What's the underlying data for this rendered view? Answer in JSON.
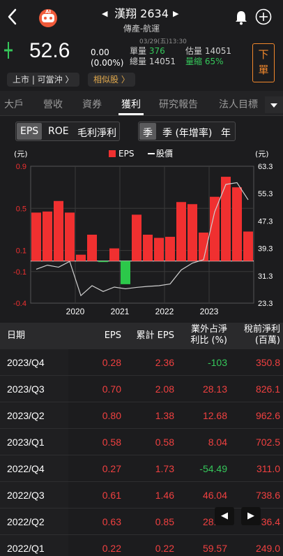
{
  "header": {
    "stock_name": "漢翔 2634",
    "stock_category": "傳產-航運",
    "ai_label": "AI",
    "prev_arrow": "◀",
    "next_arrow": "▶"
  },
  "quote": {
    "timestamp": "03/29(五)13:30",
    "price": "52.6",
    "change": "0.00",
    "change_pct": "(0.00%)",
    "vol_label": "單量",
    "vol_value": "376",
    "total_label": "總量",
    "total_value": "14051",
    "est_label": "估量",
    "est_value": "14051",
    "shrink_label": "量縮",
    "shrink_value": "65%",
    "order_button": "下單",
    "listing_pill": "上市 | 可當沖 〉",
    "similar_pill": "相似股 〉"
  },
  "tabs": [
    "大戶",
    "營收",
    "資券",
    "獲利",
    "研究報告",
    "法人目標"
  ],
  "active_tab": "獲利",
  "filters": {
    "metric": [
      "EPS",
      "ROE",
      "毛利淨利"
    ],
    "metric_selected": "EPS",
    "period": [
      "季",
      "季 (年增率)",
      "年"
    ],
    "period_selected": "季"
  },
  "chart_data": {
    "type": "bar",
    "legend": [
      "EPS",
      "股價"
    ],
    "left_unit": "(元)",
    "right_unit": "(元)",
    "left_ticks": [
      "0.9",
      "0.5",
      "0.1",
      "-0.1",
      "-0.4"
    ],
    "left_tick_values": [
      0.9,
      0.5,
      0.1,
      -0.1,
      -0.4
    ],
    "right_ticks": [
      "63.3",
      "55.3",
      "47.3",
      "39.3",
      "31.3",
      "23.3"
    ],
    "x_ticks": [
      "2020",
      "2021",
      "2022",
      "2023"
    ],
    "ylim": [
      -0.4,
      0.9
    ],
    "y2lim": [
      23.3,
      63.3
    ],
    "eps_values": [
      0.46,
      0.47,
      0.57,
      0.46,
      0.06,
      0.25,
      -0.01,
      0.12,
      -0.22,
      0.44,
      0.25,
      0.22,
      0.23,
      0.56,
      0.54,
      0.27,
      0.61,
      0.8,
      0.7,
      0.28
    ],
    "price_values": [
      33.2,
      34.4,
      33.8,
      35.5,
      25.5,
      28.4,
      26.7,
      28.0,
      27.5,
      27.9,
      28.2,
      28.4,
      28.9,
      33.0,
      35.0,
      36.0,
      50.0,
      58.0,
      58.5,
      53.5
    ],
    "positive_color": "#f03030",
    "negative_color": "#2cc84a",
    "price_color": "#cfcfcf"
  },
  "table": {
    "headers": [
      "日期",
      "EPS",
      "累計 EPS",
      "業外占淨\n利比 (%)",
      "稅前淨利\n(百萬)"
    ],
    "header_line1": [
      "日期",
      "EPS",
      "累計 EPS",
      "業外占淨",
      "稅前淨利"
    ],
    "header_line2": [
      "",
      "",
      "",
      "利比 (%)",
      "(百萬)"
    ],
    "rows": [
      [
        "2023/Q4",
        "0.28",
        "2.36",
        "-103",
        "350.8"
      ],
      [
        "2023/Q3",
        "0.70",
        "2.08",
        "28.13",
        "826.1"
      ],
      [
        "2023/Q2",
        "0.80",
        "1.38",
        "12.68",
        "962.6"
      ],
      [
        "2023/Q1",
        "0.58",
        "0.58",
        "8.04",
        "702.5"
      ],
      [
        "2022/Q4",
        "0.27",
        "1.73",
        "-54.49",
        "311.0"
      ],
      [
        "2022/Q3",
        "0.61",
        "1.46",
        "46.04",
        "738.6"
      ],
      [
        "2022/Q2",
        "0.63",
        "0.85",
        "28.39",
        "736.4"
      ],
      [
        "2022/Q1",
        "0.22",
        "0.22",
        "59.57",
        "249.0"
      ]
    ]
  },
  "pager": {
    "prev": "◀",
    "next": "▶"
  }
}
